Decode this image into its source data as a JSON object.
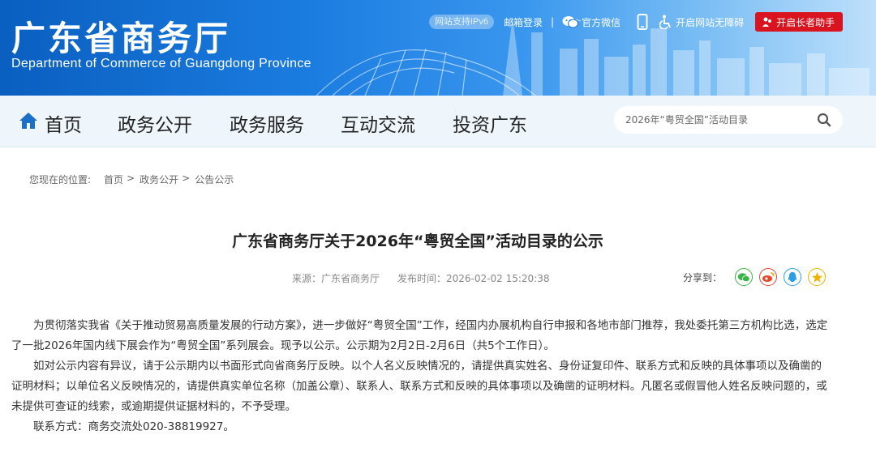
{
  "header": {
    "logo_cn": "广东省商务厅",
    "logo_en": "Department of Commerce of Guangdong Province",
    "ipv6": "网站支持IPv6",
    "mail_login": "邮箱登录",
    "separator": "|",
    "wechat": "官方微信",
    "accessibility": "开启网站无障碍",
    "elder_mode": "开启长者助手"
  },
  "nav": {
    "items": [
      "首页",
      "政务公开",
      "政务服务",
      "互动交流",
      "投资广东"
    ],
    "search_placeholder": "2026年“粤贸全国”活动目录"
  },
  "breadcrumb": {
    "label": "您现在的位置:",
    "items": [
      "首页",
      "政务公开",
      "公告公示"
    ],
    "sep": ">"
  },
  "article": {
    "title": "广东省商务厅关于2026年“粤贸全国”活动目录的公示",
    "source": "来源：广东省商务厅",
    "published": "发布时间：2026-02-02 15:20:38",
    "share_label": "分享到：",
    "paragraphs": [
      "为贯彻落实我省《关于推动贸易高质量发展的行动方案》，进一步做好“粤贸全国”工作，经国内办展机构自行申报和各地市部门推荐，我处委托第三方机构比选，选定了一批2026年国内线下展会作为“粤贸全国”系列展会。现予以公示。公示期为2月2日-2月6日（共5个工作日）。",
      "如对公示内容有异议，请于公示期内以书面形式向省商务厅反映。以个人名义反映情况的，请提供真实姓名、身份证复印件、联系方式和反映的具体事项以及确凿的证明材料；以单位名义反映情况的，请提供真实单位名称（加盖公章）、联系人、联系方式和反映的具体事项以及确凿的证明材料。凡匿名或假冒他人姓名反映问题的，或未提供可查证的线索，或逾期提供证据材料的，不予受理。",
      "联系方式：商务交流处020-38819927。"
    ]
  },
  "colors": {
    "banner_start": "#0a5fc0",
    "nav_bg": "#eef6fc",
    "elder_red": "#d9141f",
    "share_wechat": "#3bb44a",
    "share_weibo": "#e6462b",
    "share_qq": "#2a9ee6",
    "share_qzone": "#f0b400"
  }
}
